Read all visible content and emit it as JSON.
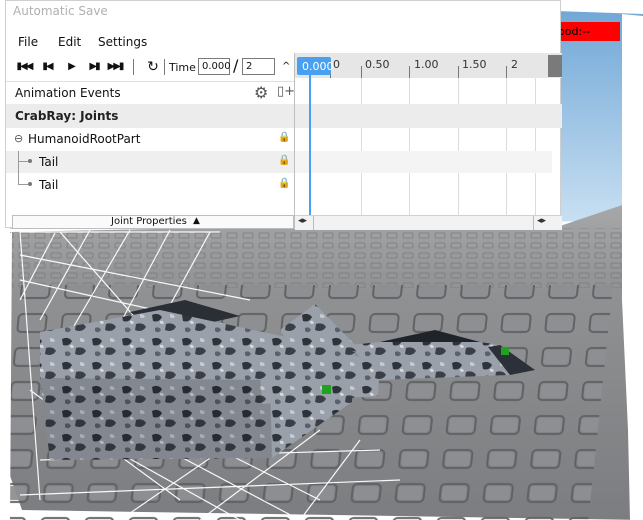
{
  "window": {
    "title": "Automatic Save"
  },
  "viewport": {
    "badge_text": "ood:--"
  },
  "menu": {
    "items": [
      "File",
      "Edit",
      "Settings"
    ]
  },
  "toolbar": {
    "time_label": "Time",
    "current_time": "0.000",
    "separator": "/",
    "length": "2",
    "collapse_icon": "^"
  },
  "events": {
    "label": "Animation Events"
  },
  "rig": {
    "name": "CrabRay: Joints",
    "root": {
      "expander": "⊖",
      "label": "HumanoidRootPart"
    },
    "children": [
      {
        "label": "Tail",
        "locked_dark": true
      },
      {
        "label": "Tail",
        "locked_dark": false
      }
    ]
  },
  "joint_properties": {
    "label": "Joint Properties",
    "arrow": "▲"
  },
  "timeline": {
    "playhead_time": "0.000",
    "ticks": [
      "0",
      "0.50",
      "1.00",
      "1.50",
      "2"
    ]
  },
  "colors": {
    "accent": "#4aa0f0",
    "badge": "#ff0000"
  },
  "icons": {
    "first": "skip-to-start-icon",
    "prev": "step-back-icon",
    "play": "play-icon",
    "next": "step-forward-icon",
    "last": "skip-to-end-icon",
    "loop": "loop-icon",
    "gear": "gear-icon",
    "addkey": "add-keyframe-icon",
    "lock": "lock-icon"
  }
}
